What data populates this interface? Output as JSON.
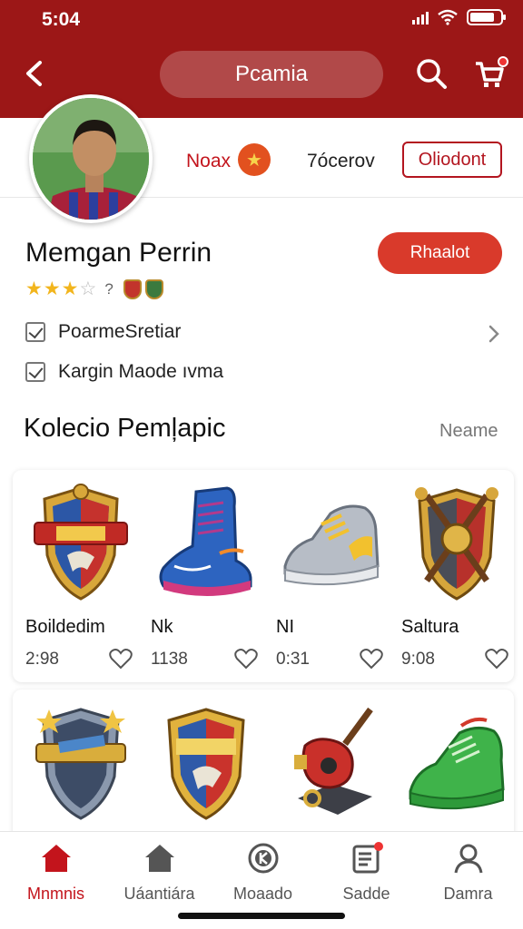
{
  "status_bar": {
    "time": "5:04"
  },
  "header": {
    "title": "Pcamia"
  },
  "profile": {
    "coins_label": "Noax",
    "stat_label": "7ócerov",
    "outline_button": "Oliodont"
  },
  "player": {
    "name": "Memgan Perrin",
    "rating": 3,
    "rating_number": "?",
    "action_button": "Rhaalot"
  },
  "checklist": [
    {
      "label": "PoarmeSretiar"
    },
    {
      "label": "Kargin Maode ıvma"
    }
  ],
  "collection": {
    "title": "Kolecio Pemļapic",
    "link": "Neame",
    "items": [
      {
        "name": "Boildedim",
        "price": "2:98",
        "icon": "shield-badge-icon"
      },
      {
        "name": "Nk",
        "price": "1138",
        "icon": "sneaker-icon"
      },
      {
        "name": "NI",
        "price": "0:31",
        "icon": "sneaker-icon"
      },
      {
        "name": "Saltura",
        "price": "9:08",
        "icon": "shield-badge-icon"
      }
    ],
    "items_row2": [
      {
        "icon": "shield-badge-icon"
      },
      {
        "icon": "shield-badge-icon"
      },
      {
        "icon": "guitar-trophy-icon"
      },
      {
        "icon": "sneaker-icon"
      }
    ]
  },
  "nav": [
    {
      "label": "Mnmnis",
      "icon": "home-icon",
      "active": true
    },
    {
      "label": "Uáantiára",
      "icon": "home-icon",
      "active": false
    },
    {
      "label": "Moaado",
      "icon": "mode-icon",
      "active": false
    },
    {
      "label": "Sadde",
      "icon": "news-icon",
      "active": false
    },
    {
      "label": "Damra",
      "icon": "profile-icon",
      "active": false
    }
  ],
  "colors": {
    "brand": "#9c1717",
    "accent": "#d93a2b",
    "star": "#f2b51d"
  }
}
